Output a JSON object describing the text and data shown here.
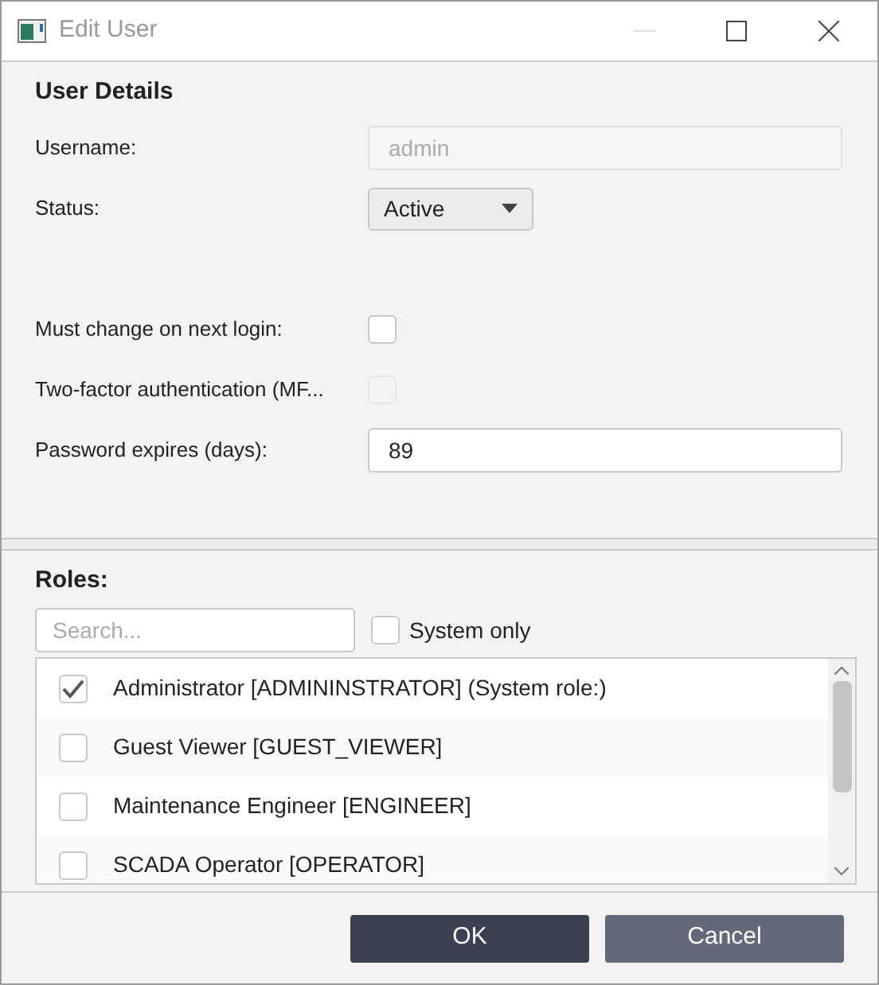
{
  "window": {
    "title": "Edit User"
  },
  "user_details": {
    "heading": "User Details",
    "fields": [
      {
        "kind": "text",
        "label": "Username:",
        "value": "admin",
        "disabled": true
      },
      {
        "kind": "select",
        "label": "Status:",
        "value": "Active"
      },
      {
        "kind": "spacer"
      },
      {
        "kind": "checkbox",
        "label": "Must change on next login:",
        "checked": false,
        "disabled": false
      },
      {
        "kind": "checkbox",
        "label": "Two-factor authentication (MF...",
        "checked": false,
        "disabled": true
      },
      {
        "kind": "text",
        "label": "Password expires (days):",
        "value": "89",
        "disabled": false
      }
    ]
  },
  "roles": {
    "heading": "Roles:",
    "search": {
      "placeholder": "Search..."
    },
    "system_only": {
      "label": "System only",
      "checked": false
    },
    "items": [
      {
        "label": "Administrator [ADMININSTRATOR] (System role:)",
        "checked": true
      },
      {
        "label": "Guest Viewer [GUEST_VIEWER]",
        "checked": false
      },
      {
        "label": "Maintenance Engineer [ENGINEER]",
        "checked": false
      },
      {
        "label": "SCADA Operator [OPERATOR]",
        "checked": false
      }
    ]
  },
  "buttons": [
    {
      "label": "OK",
      "kind": "primary"
    },
    {
      "label": "Cancel",
      "kind": "secondary"
    }
  ]
}
